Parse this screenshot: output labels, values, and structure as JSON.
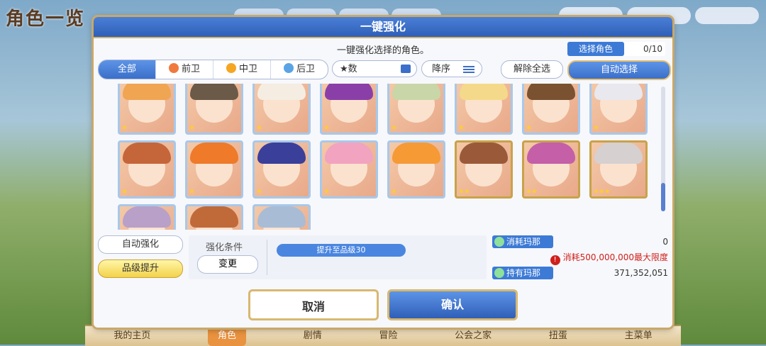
{
  "background": {
    "title": "角色一览",
    "bottom_nav": [
      "我的主页",
      "角色",
      "剧情",
      "冒险",
      "公会之家",
      "扭蛋",
      "主菜单"
    ],
    "active_nav": "角色"
  },
  "dialog": {
    "title": "一键强化",
    "subtitle": "一键强化选择的角色。",
    "select_label": "选择角色",
    "select_count": "0/10"
  },
  "filters": {
    "tabs": [
      "全部",
      "前卫",
      "中卫",
      "后卫"
    ],
    "active": "全部",
    "star_label": "★数",
    "sort_label": "降序",
    "clear_label": "解除全选",
    "auto_select_label": "自动选择"
  },
  "characters": {
    "row1": [
      {
        "hair": "#f0a552",
        "stars": "★"
      },
      {
        "hair": "#6b5a48",
        "stars": "★"
      },
      {
        "hair": "#f5ede2",
        "stars": "★"
      },
      {
        "hair": "#8a3fa8",
        "stars": "★"
      },
      {
        "hair": "#c9d6a8",
        "stars": "★"
      },
      {
        "hair": "#f5d98a",
        "stars": "★"
      },
      {
        "hair": "#7a5232",
        "stars": "★"
      },
      {
        "hair": "#e8e8ee",
        "stars": "★"
      }
    ],
    "row2": [
      {
        "hair": "#c5663a",
        "stars": "★"
      },
      {
        "hair": "#ee7a2a",
        "stars": "★"
      },
      {
        "hair": "#3a3f9a",
        "stars": "★"
      },
      {
        "hair": "#f2a3bf",
        "stars": "★"
      },
      {
        "hair": "#f59a35",
        "stars": "★"
      },
      {
        "hair": "#9a5a3a",
        "stars": "★★"
      },
      {
        "hair": "#c45fa8",
        "stars": "★★"
      },
      {
        "hair": "#d6d0d0",
        "stars": "★★★"
      }
    ],
    "row3": [
      {
        "hair": "#b8a0c8",
        "stars": ""
      },
      {
        "hair": "#c06a3a",
        "stars": ""
      },
      {
        "hair": "#a8bcd6",
        "stars": ""
      }
    ]
  },
  "controls": {
    "auto_enhance": "自动强化",
    "rank_up": "品级提升",
    "condition_label": "强化条件",
    "change_label": "变更",
    "condition_tag": "提升至品级30"
  },
  "mana": {
    "cost_label": "消耗玛那",
    "cost_value": "0",
    "warning": "消耗500,000,000最大限度",
    "own_label": "持有玛那",
    "own_value": "371,352,051"
  },
  "actions": {
    "cancel": "取消",
    "confirm": "确认"
  },
  "colors": {
    "accent": "#3b6fc9",
    "gold": "#d8b870",
    "warning": "#d0201c"
  }
}
